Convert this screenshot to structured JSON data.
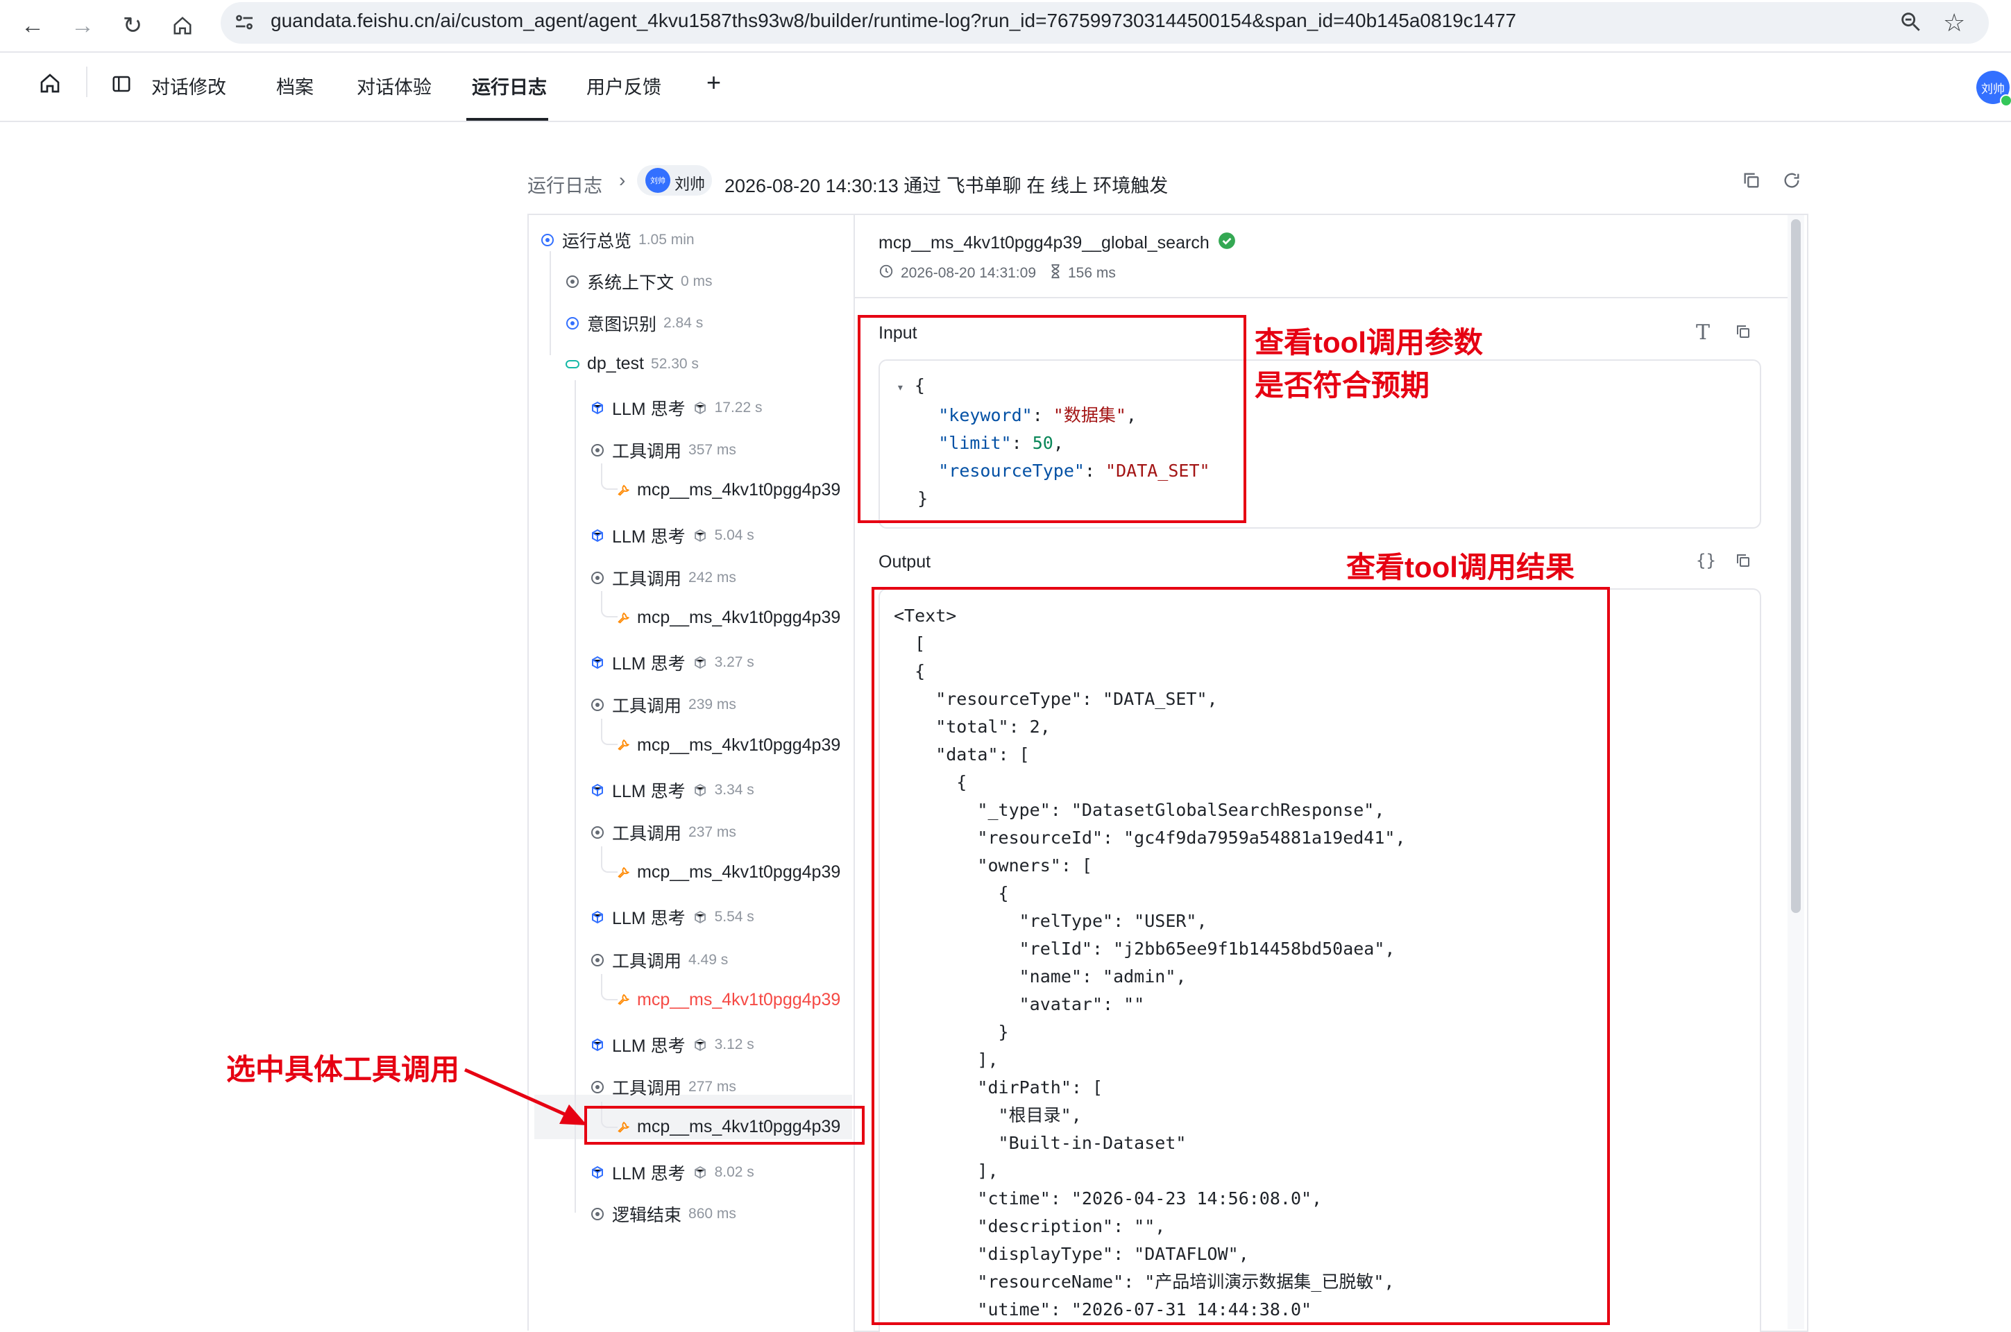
{
  "browser": {
    "url": "guandata.feishu.cn/ai/custom_agent/agent_4kvu1587ths93w8/builder/runtime-log?run_id=7675997303144500154&span_id=40b145a0819c1477"
  },
  "nav": {
    "tabs": [
      "对话修改",
      "档案",
      "对话体验",
      "运行日志",
      "用户反馈"
    ],
    "active": "运行日志",
    "add": "+",
    "avatar": "刘帅"
  },
  "breadcrumb": {
    "root": "运行日志",
    "avatar": "刘帅",
    "user": "刘帅",
    "desc": "2026-08-20 14:30:13 通过 飞书单聊 在 线上 环境触发"
  },
  "tree": {
    "overview": {
      "label": "运行总览",
      "meta": "1.05 min"
    },
    "system": {
      "label": "系统上下文",
      "meta": "0 ms"
    },
    "intent": {
      "label": "意图识别",
      "meta": "2.84 s"
    },
    "dp": {
      "label": "dp_test",
      "meta": "52.30 s"
    },
    "llm_label": "LLM 思考",
    "tool_label": "工具调用",
    "leaf_label": "mcp__ms_4kv1t0pgg4p39",
    "end": {
      "label": "逻辑结束",
      "meta": "860 ms"
    },
    "llm_metas": [
      "17.22 s",
      "5.04 s",
      "3.27 s",
      "3.34 s",
      "5.54 s",
      "3.12 s",
      "8.02 s"
    ],
    "tool_metas": [
      "357 ms",
      "242 ms",
      "239 ms",
      "237 ms",
      "4.49 s",
      "277 ms"
    ]
  },
  "detail": {
    "title": "mcp__ms_4kv1t0pgg4p39__global_search",
    "time": "2026-08-20 14:31:09",
    "duration": "156 ms",
    "input_label": "Input",
    "output_label": "Output",
    "input_json": {
      "keyword": "数据集",
      "limit": 50,
      "resourceType": "DATA_SET"
    },
    "output_lines": [
      "<Text>",
      "  [",
      "  {",
      "    \"resourceType\": \"DATA_SET\",",
      "    \"total\": 2,",
      "    \"data\": [",
      "      {",
      "        \"_type\": \"DatasetGlobalSearchResponse\",",
      "        \"resourceId\": \"gc4f9da7959a54881a19ed41\",",
      "        \"owners\": [",
      "          {",
      "            \"relType\": \"USER\",",
      "            \"relId\": \"j2bb65ee9f1b14458bd50aea\",",
      "            \"name\": \"admin\",",
      "            \"avatar\": \"\"",
      "          }",
      "        ],",
      "        \"dirPath\": [",
      "          \"根目录\",",
      "          \"Built-in-Dataset\"",
      "        ],",
      "        \"ctime\": \"2026-04-23 14:56:08.0\",",
      "        \"description\": \"\",",
      "        \"displayType\": \"DATAFLOW\",",
      "        \"resourceName\": \"产品培训演示数据集_已脱敏\",",
      "        \"utime\": \"2026-07-31 14:44:38.0\""
    ]
  },
  "annotations": {
    "input_note_1": "查看tool调用参数",
    "input_note_2": "是否符合预期",
    "output_note": "查看tool调用结果",
    "select_note": "选中具体工具调用"
  },
  "colors": {
    "annotation": "#e60012",
    "accent": "#3370ff",
    "success": "#34a853",
    "error": "#f54a45"
  }
}
